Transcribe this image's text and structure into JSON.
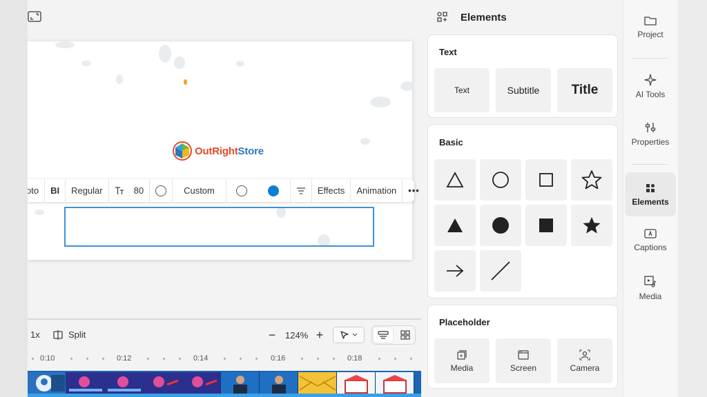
{
  "toolbar": {
    "font_name_partial": "oto",
    "style_buttons": "BI",
    "font_weight": "Regular",
    "font_size": "80",
    "color_mode": "Custom",
    "effects_label": "Effects",
    "animation_label": "Animation",
    "more_label": "•••"
  },
  "canvas": {
    "logo_text_part1": "OutRight",
    "logo_text_part2": "Store"
  },
  "timeline": {
    "speed": "1x",
    "split_label": "Split",
    "zoom_level": "124%",
    "ruler_labels": [
      "0:10",
      "0:12",
      "0:14",
      "0:16",
      "0:18"
    ]
  },
  "panel": {
    "title": "Elements",
    "text_section": {
      "title": "Text",
      "items": [
        "Text",
        "Subtitle",
        "Title"
      ]
    },
    "basic_section": {
      "title": "Basic"
    },
    "placeholder_section": {
      "title": "Placeholder",
      "items": [
        "Media",
        "Screen",
        "Camera"
      ]
    }
  },
  "nav": {
    "items": [
      "Project",
      "AI Tools",
      "Properties",
      "Elements",
      "Captions",
      "Media"
    ],
    "active": "Elements"
  },
  "colors": {
    "accent": "#3c91d8",
    "fill_color": "#0b7fcf",
    "filmstrip": "#1a66b3"
  }
}
